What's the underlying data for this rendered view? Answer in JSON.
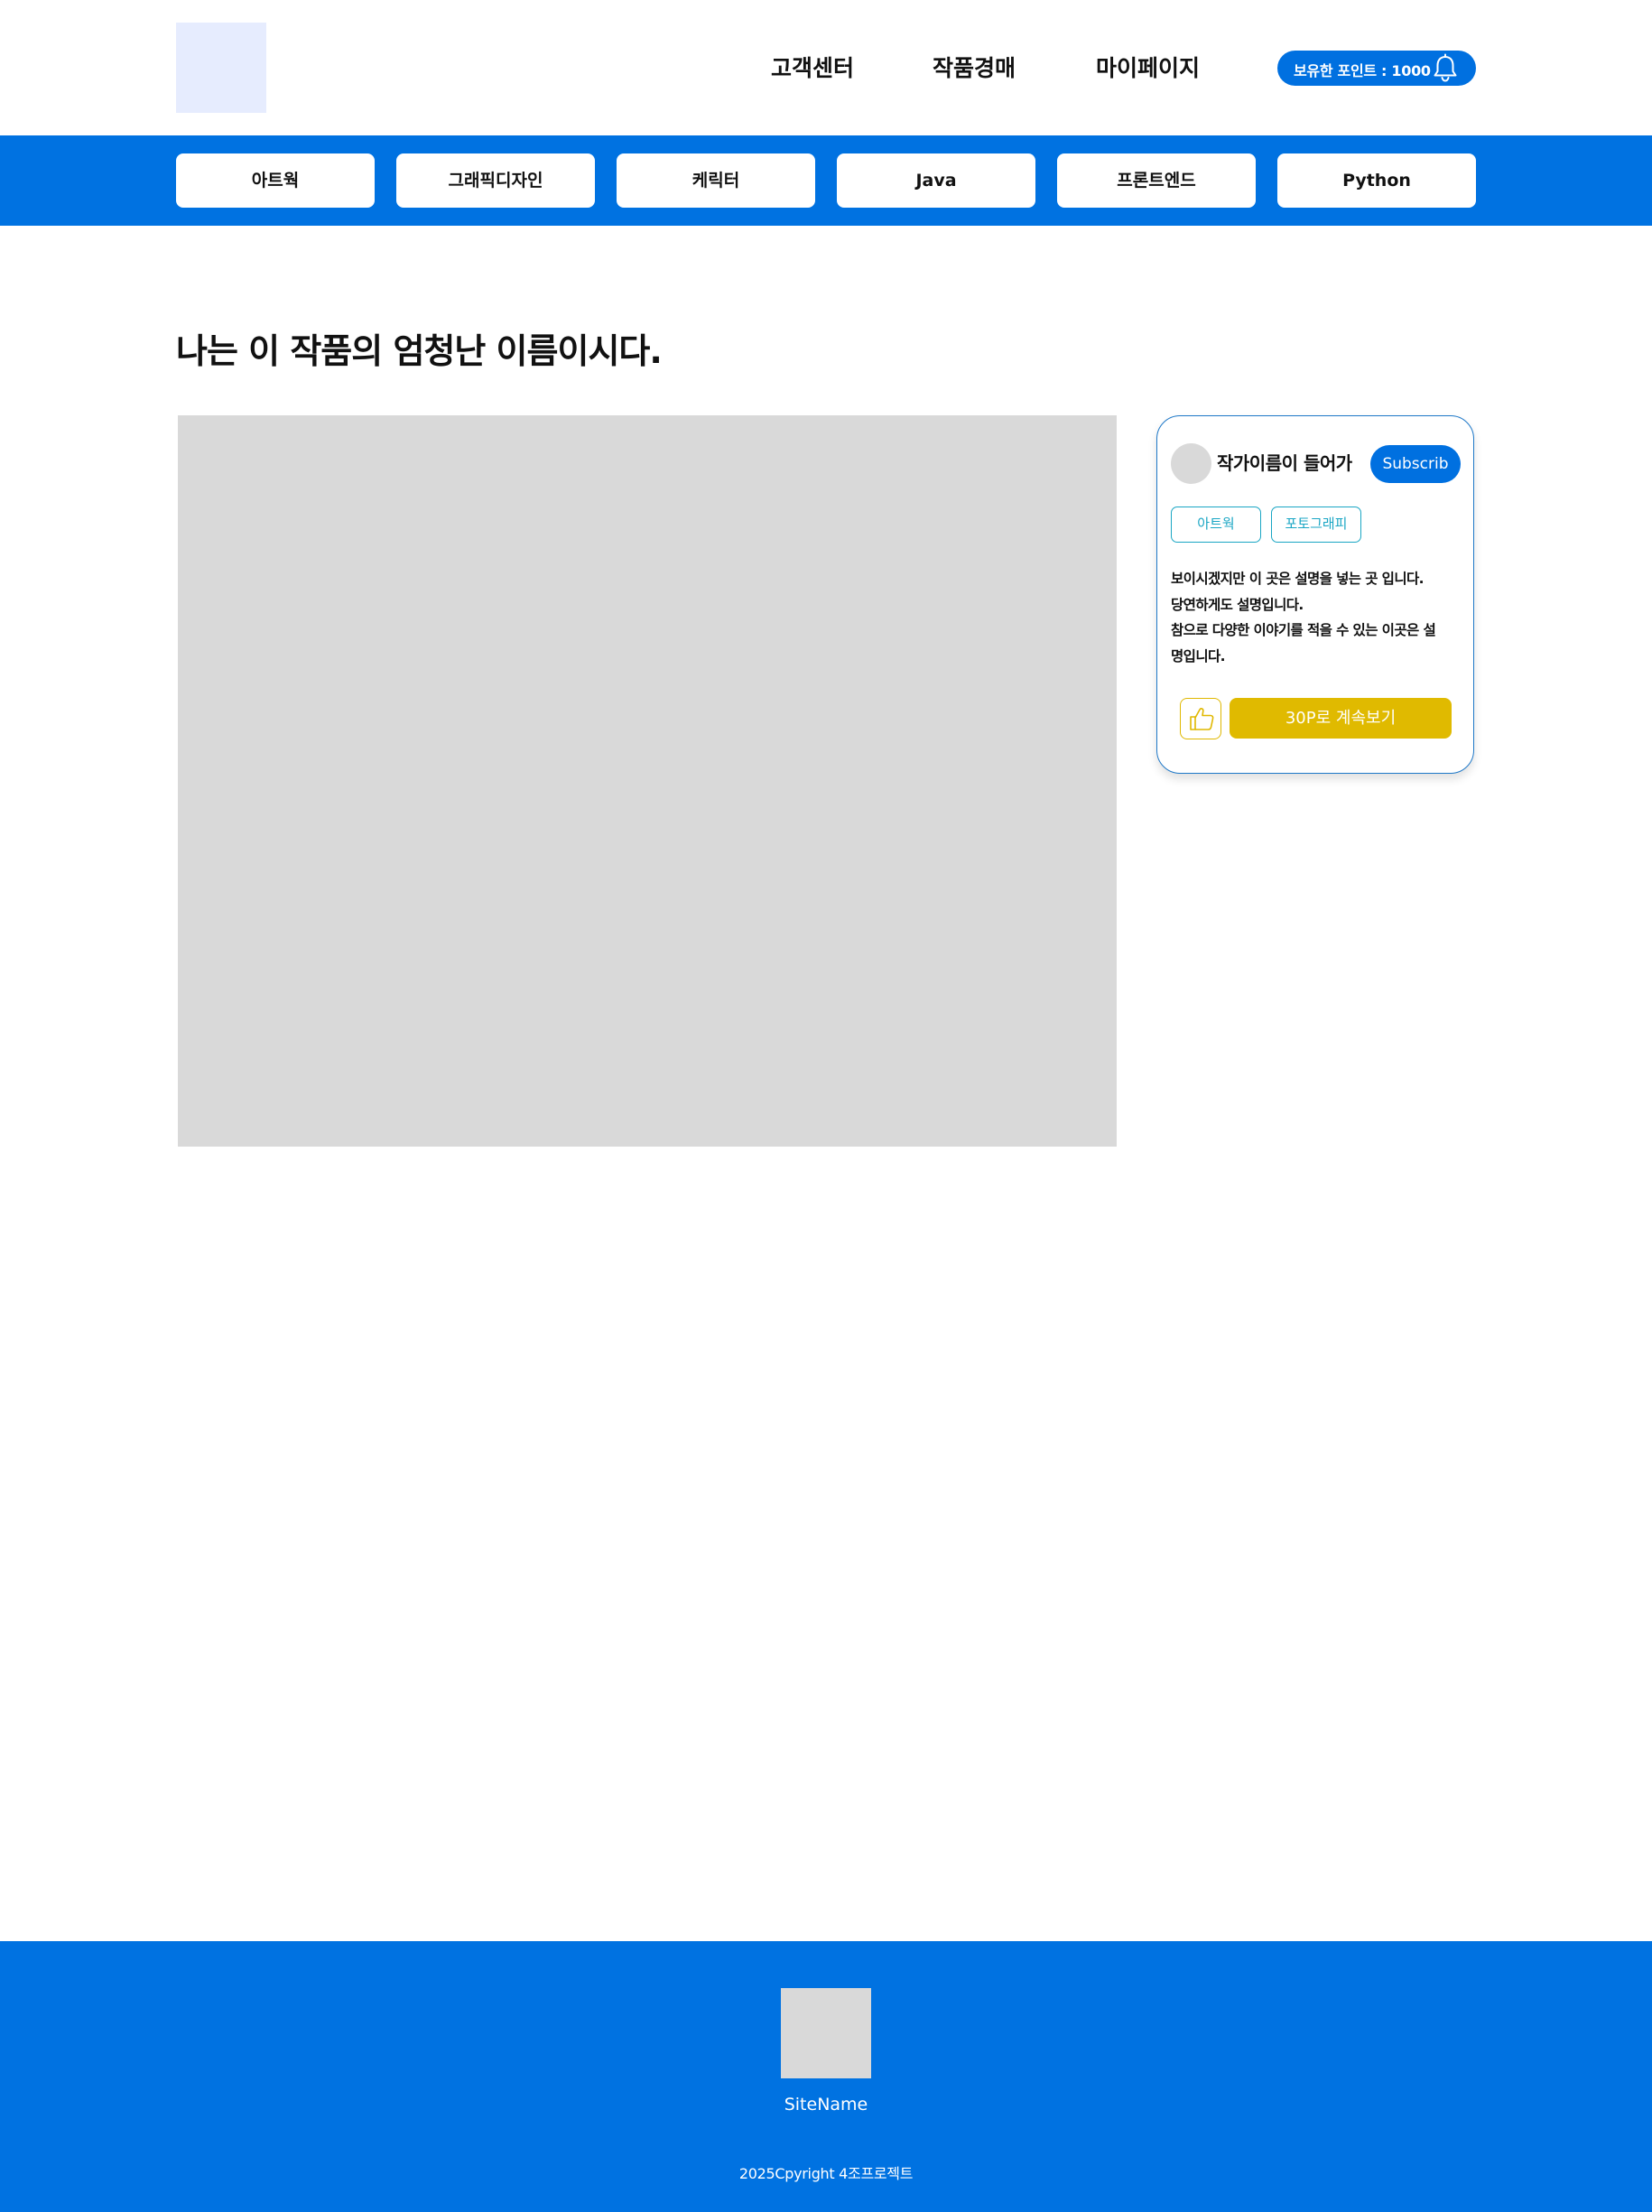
{
  "header": {
    "nav": [
      "고객센터",
      "작품경매",
      "마이페이지"
    ],
    "points_label": "보유한 포인트 : 1000"
  },
  "categories": [
    "아트웍",
    "그래픽디자인",
    "케릭터",
    "Java",
    "프론트엔드",
    "Python"
  ],
  "artwork": {
    "title": "나는 이 작품의 엄청난 이름이시다."
  },
  "side_card": {
    "author_name": "작가이름이 들어가",
    "subscribe_label": "Subscrib",
    "tags": [
      "아트웍",
      "포토그래피"
    ],
    "description_lines": [
      "보이시겠지만 이 곳은 설명을 넣는 곳 입니다.",
      "당연하게도 설명입니다.",
      "참으로 다양한 이야기를 적을 수 있는 이곳은 설",
      "명입니다."
    ],
    "continue_label": "30P로 계속보기"
  },
  "footer": {
    "site_name": "SiteName",
    "copyright": "2025Cpyright 4조프로젝트"
  },
  "colors": {
    "primary": "#0072e1",
    "accent_yellow": "#e0ba00",
    "tag_teal": "#1aa6c4",
    "placeholder_gray": "#d9d9d9",
    "logo_bg": "#e6ecfe"
  }
}
